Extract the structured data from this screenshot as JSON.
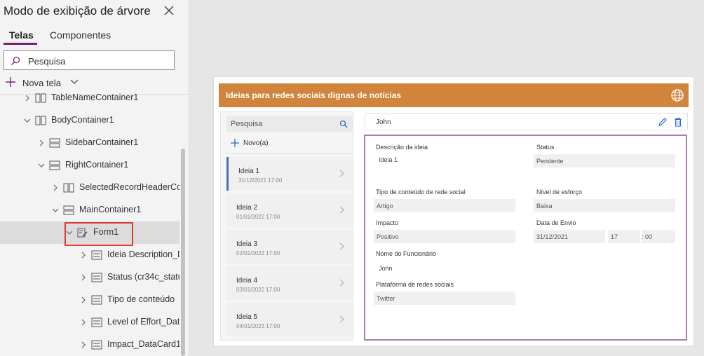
{
  "tree_panel": {
    "title": "Modo de exibição de árvore",
    "tabs": [
      {
        "label": "Telas"
      },
      {
        "label": "Componentes"
      }
    ],
    "search_placeholder": "Pesquisa",
    "new_screen_label": "Nova tela",
    "items": [
      {
        "label": "TableNameContainer1"
      },
      {
        "label": "BodyContainer1"
      },
      {
        "label": "SidebarContainer1"
      },
      {
        "label": "RightContainer1"
      },
      {
        "label": "SelectedRecordHeaderCon"
      },
      {
        "label": "MainContainer1"
      },
      {
        "label": "Form1"
      },
      {
        "label": "Ideia Description_D"
      },
      {
        "label": "Status (cr34c_status"
      },
      {
        "label": "Tipo de conteúdo"
      },
      {
        "label": "Level of Effort_Data"
      },
      {
        "label": "Impact_DataCard1"
      }
    ]
  },
  "app": {
    "title": "Ideias para redes sociais dignas de notícias",
    "sidebar": {
      "search_placeholder": "Pesquisa",
      "new_label": "Novo(a)",
      "items": [
        {
          "title": "Ideia 1",
          "date": "31/12/2021 17:00"
        },
        {
          "title": "Ideia 2",
          "date": "01/01/2022 17:00"
        },
        {
          "title": "Ideia 3",
          "date": "02/01/2022 17:00"
        },
        {
          "title": "Ideia 4",
          "date": "03/01/2022 17:00"
        },
        {
          "title": "Ideia 5",
          "date": "04/01/2023 17:00"
        }
      ]
    },
    "detail": {
      "header_name": "John",
      "fields": {
        "descricao_label": "Descrição da ideia",
        "descricao_value": "Ideia 1",
        "status_label": "Status",
        "status_value": "Pendente",
        "tipo_label": "Tipo de conteúdo de rede social",
        "tipo_value": "Artigo",
        "nivel_label": "Nível de esforço",
        "nivel_value": "Baixa",
        "impacto_label": "Impacto",
        "impacto_value": "Positivo",
        "data_label": "Data de Envio",
        "data_value": "31/12/2021",
        "hora_value": "17",
        "minuto_value": ": 00",
        "funcionario_label": "Nome do Funcionário",
        "funcionario_value": "John",
        "plataforma_label": "Plataforma de redes sociais",
        "plataforma_value": "Twitter"
      }
    }
  },
  "colors": {
    "header_orange": "#d1843b",
    "tab_underline": "#742774",
    "highlight_red": "#d83b3b",
    "form_border": "#a87bb3",
    "active_item": "#4b6fb8"
  }
}
